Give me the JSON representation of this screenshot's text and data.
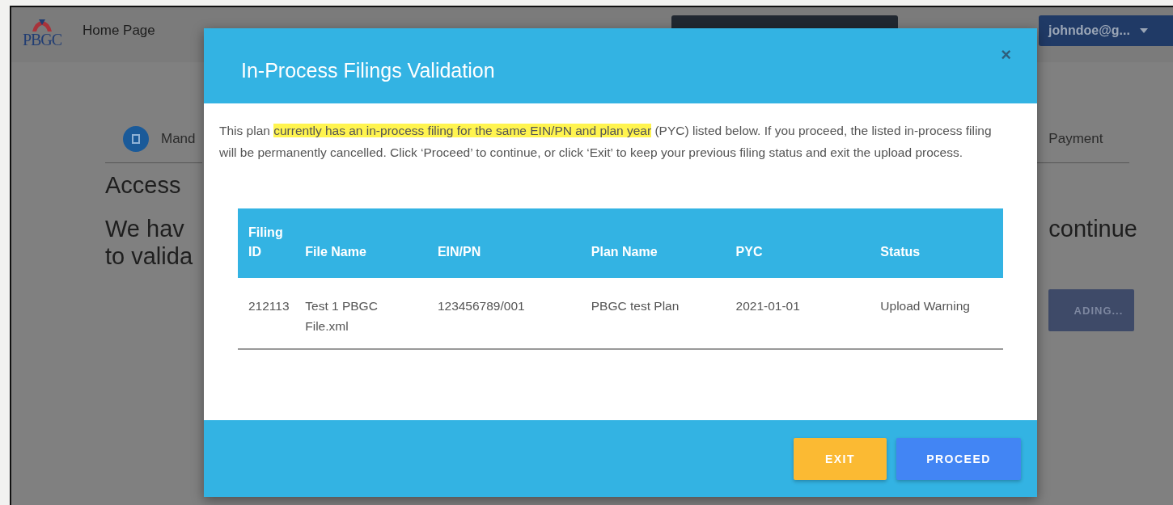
{
  "navbar": {
    "logo": "PBGC",
    "home_link": "Home Page",
    "user_menu": "johndoe@g..."
  },
  "background_page": {
    "step_label": "Mand",
    "step_right": "Payment",
    "heading": "Access",
    "line_1": "We hav",
    "line_2": "to valida",
    "line_1_right": "continue",
    "button_fragment": "ADING..."
  },
  "dialog": {
    "title": "In-Process Filings Validation",
    "close": "×",
    "message": {
      "before": "This plan ",
      "highlighted": "currently has an in-process filing for the same EIN/PN and plan year",
      "after": " (PYC) listed below. If you proceed, the listed in-process filing will be permanently cancelled. Click ‘Proceed’ to continue, or click ‘Exit’ to keep your previous filing status and exit the upload process."
    },
    "table": {
      "columns": [
        "Filing ID",
        "File Name",
        "EIN/PN",
        "Plan Name",
        "PYC",
        "Status"
      ],
      "rows": [
        [
          "212113",
          "Test 1 PBGC File.xml",
          "123456789/001",
          "PBGC test Plan",
          "2021-01-01",
          "Upload Warning"
        ]
      ]
    },
    "buttons": [
      {
        "label": "EXIT",
        "kind": "secondary"
      },
      {
        "label": "PROCEED",
        "kind": "primary"
      }
    ]
  }
}
